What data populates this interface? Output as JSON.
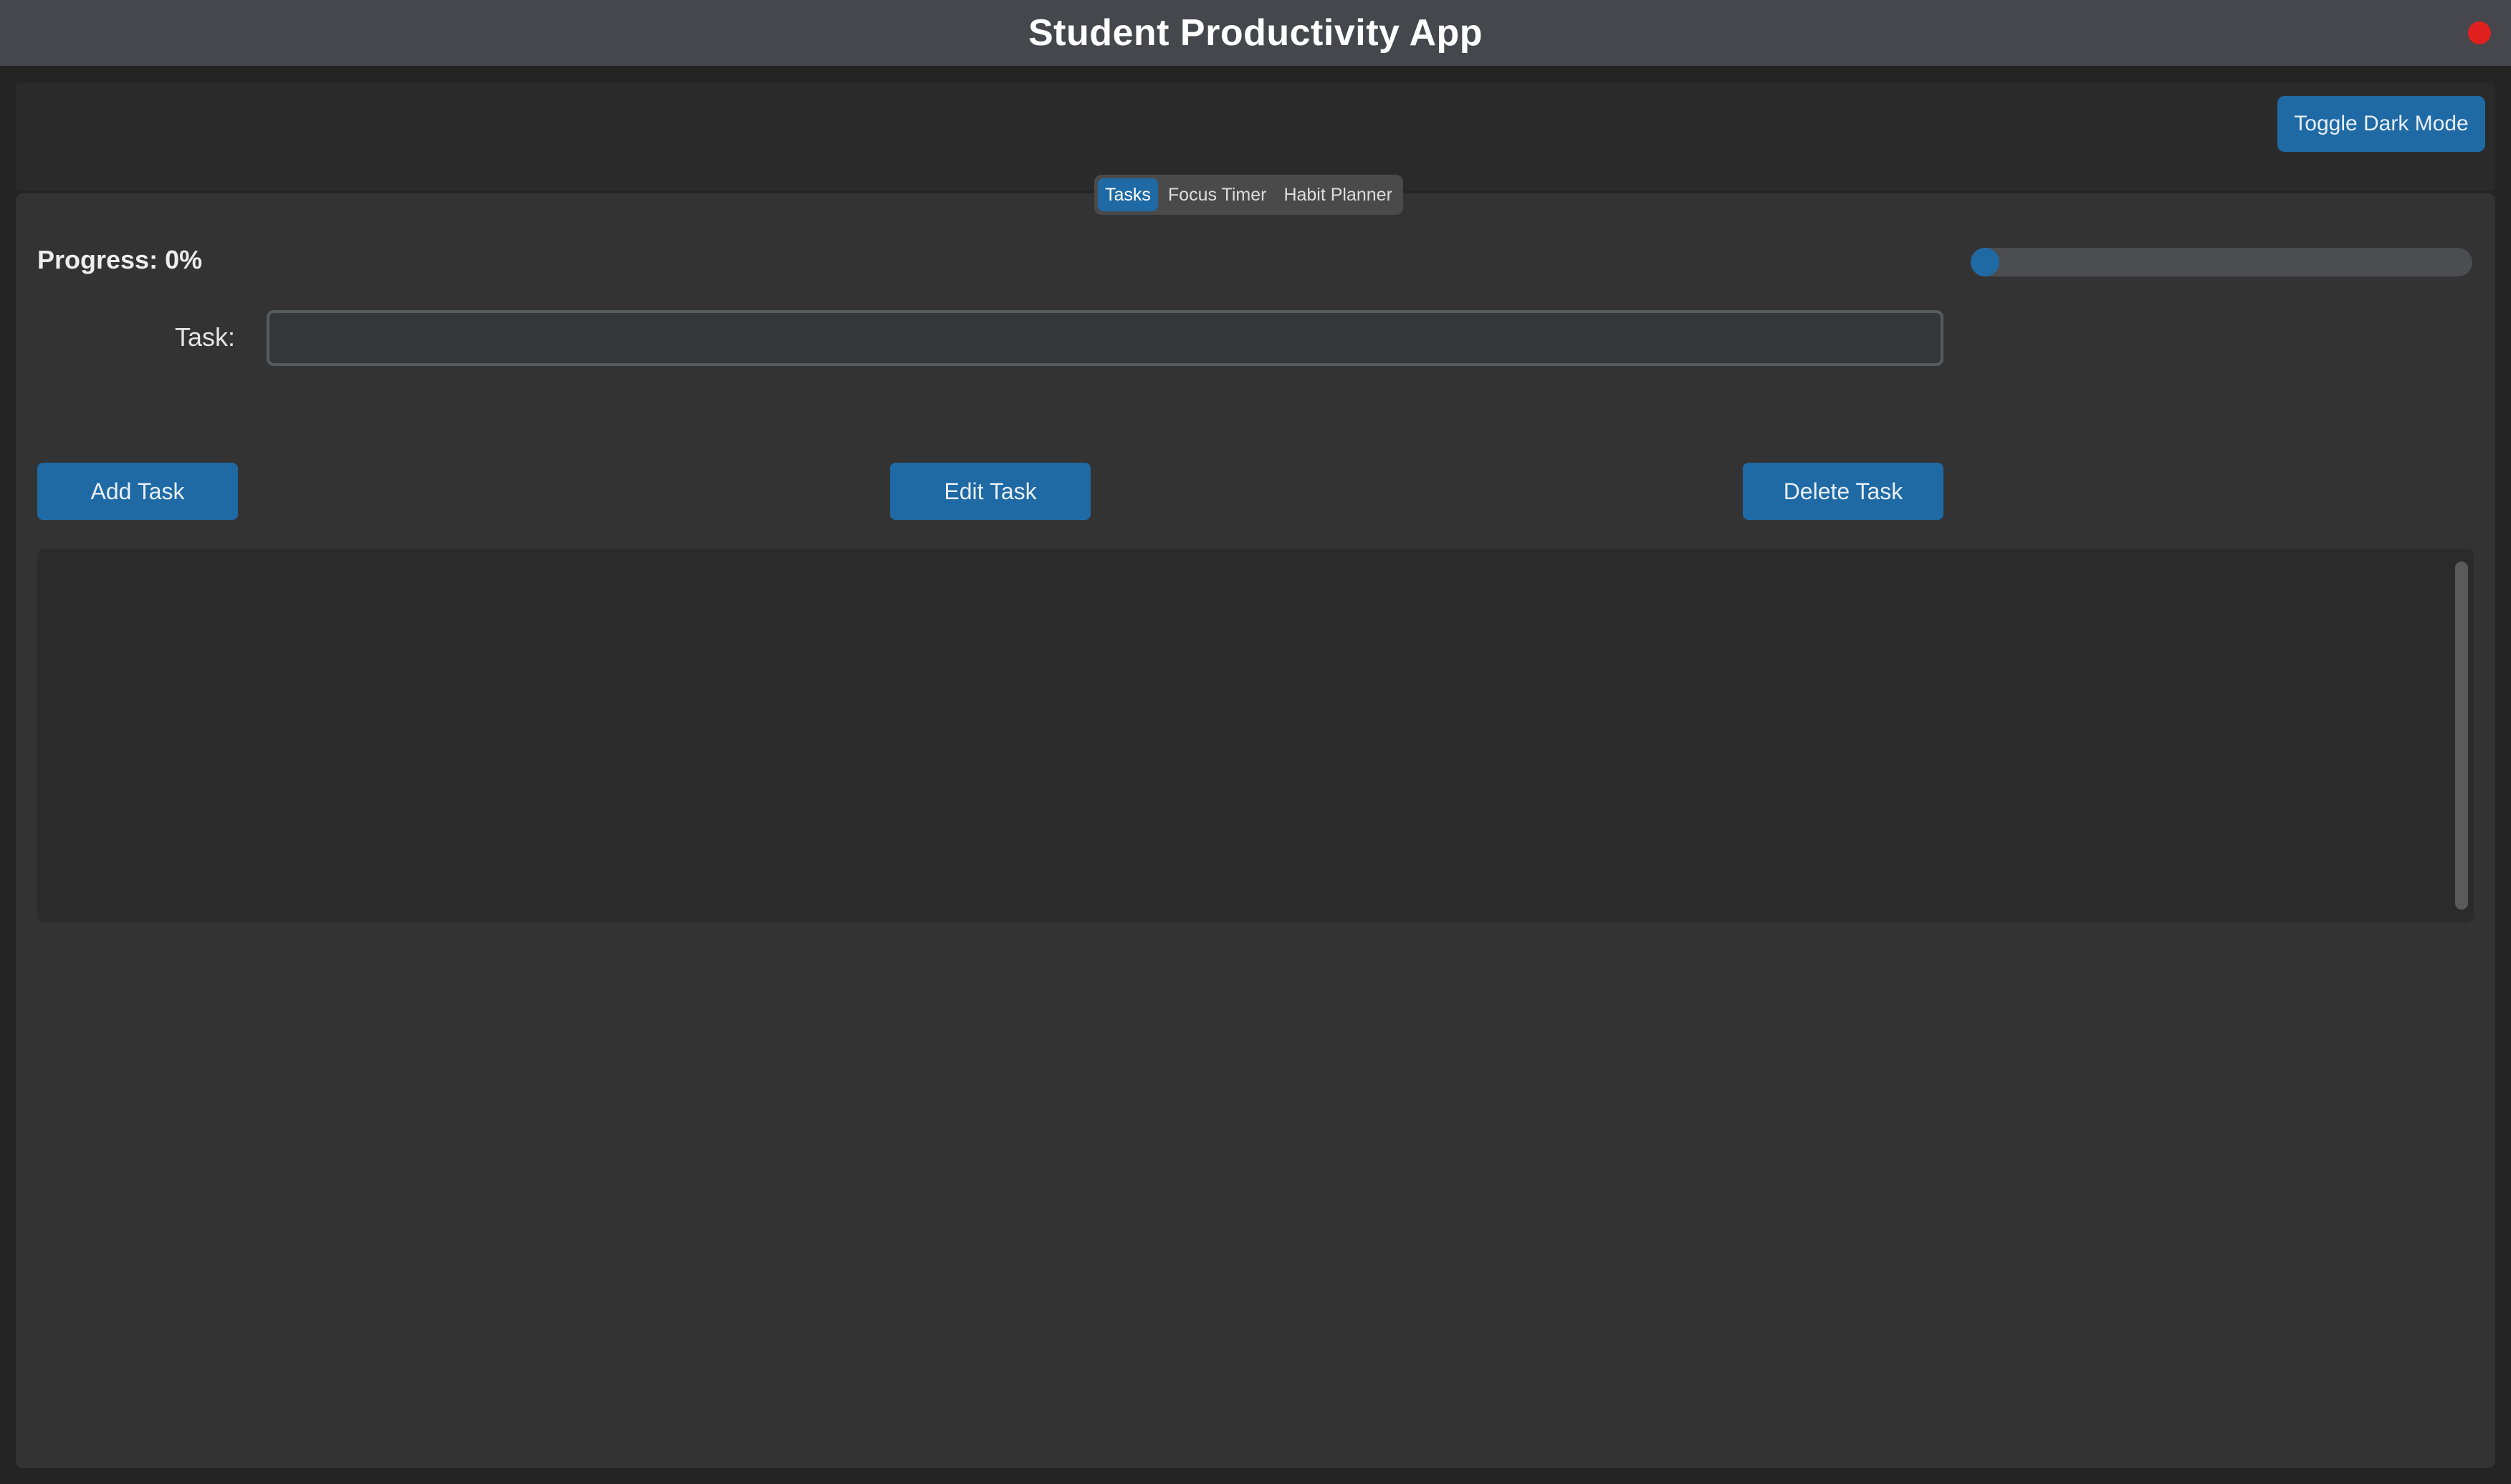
{
  "window": {
    "title": "Student Productivity App"
  },
  "header": {
    "toggle_label": "Toggle Dark Mode"
  },
  "tabs": [
    {
      "label": "Tasks",
      "active": true
    },
    {
      "label": "Focus Timer",
      "active": false
    },
    {
      "label": "Habit Planner",
      "active": false
    }
  ],
  "progress": {
    "label": "Progress: 0%",
    "fraction": 0
  },
  "task_form": {
    "label": "Task:",
    "value": "",
    "placeholder": ""
  },
  "actions": {
    "add_label": "Add Task",
    "edit_label": "Edit Task",
    "delete_label": "Delete Task"
  },
  "task_list": {
    "items": []
  },
  "colors": {
    "accent": "#1f6aa5",
    "close": "#e0201f",
    "background": "#333333"
  }
}
